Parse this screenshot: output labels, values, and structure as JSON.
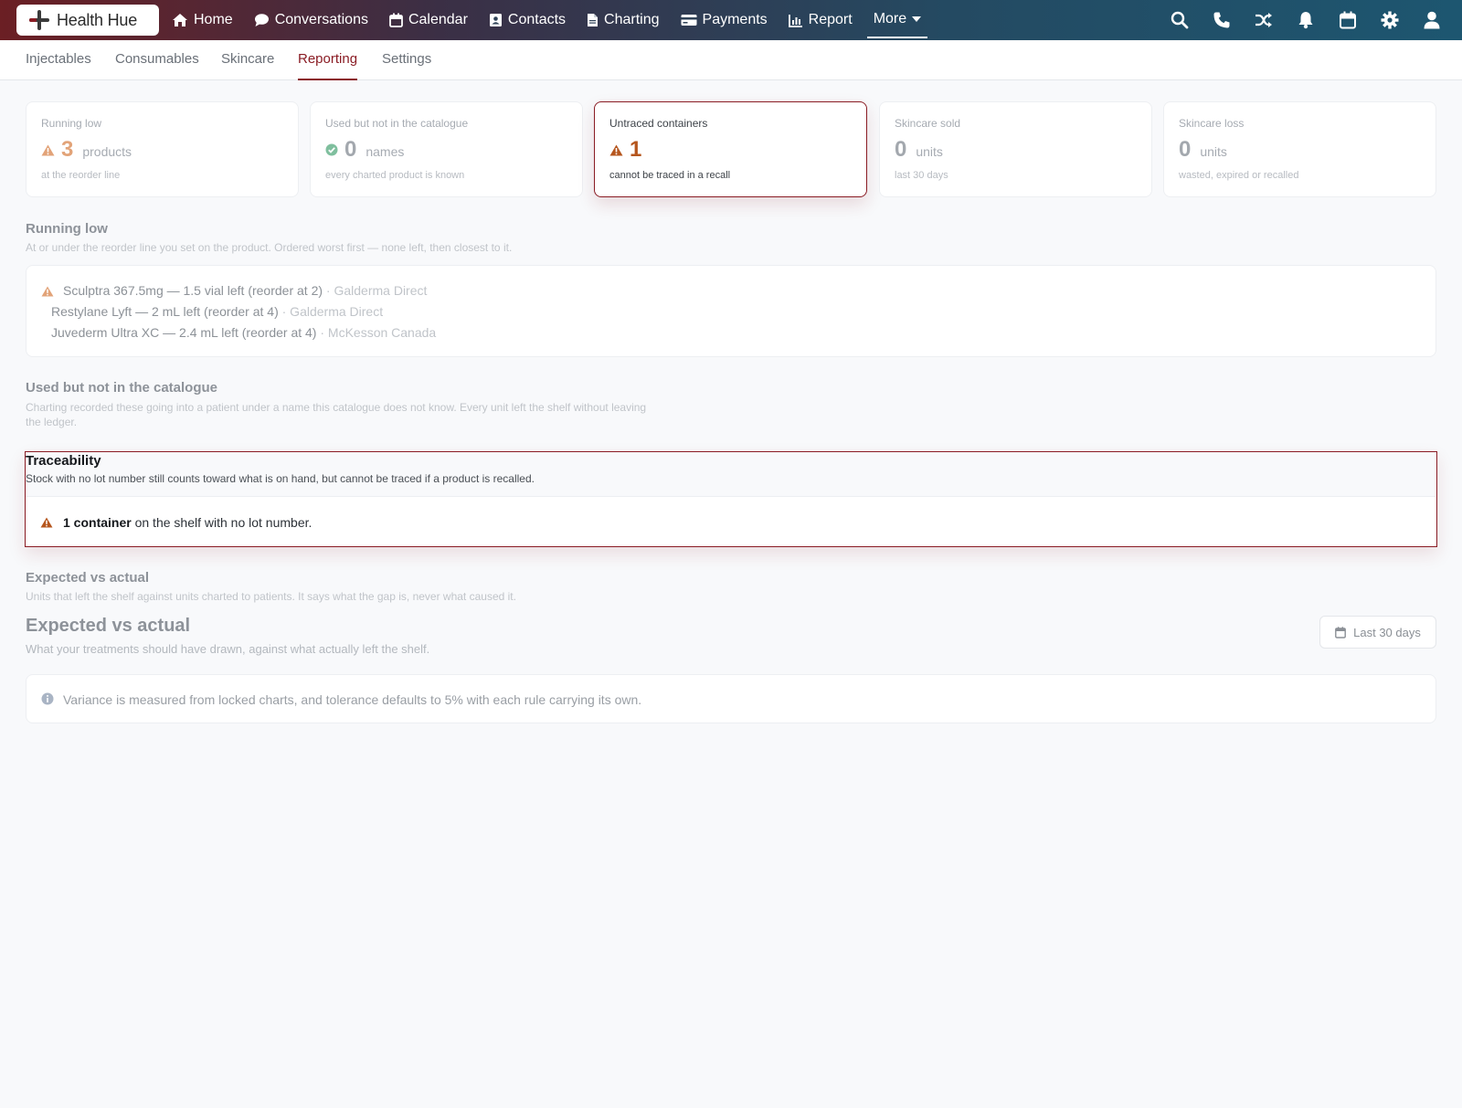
{
  "app": {
    "name": "Health Hue"
  },
  "nav": {
    "items": [
      {
        "label": "Home",
        "icon": "home-icon"
      },
      {
        "label": "Conversations",
        "icon": "chat-icon"
      },
      {
        "label": "Calendar",
        "icon": "calendar-icon"
      },
      {
        "label": "Contacts",
        "icon": "contact-card-icon"
      },
      {
        "label": "Charting",
        "icon": "document-icon"
      },
      {
        "label": "Payments",
        "icon": "credit-card-icon"
      },
      {
        "label": "Report",
        "icon": "bar-chart-icon"
      }
    ],
    "more_label": "More",
    "right_icons": [
      "search-icon",
      "phone-icon",
      "shuffle-icon",
      "bell-icon",
      "calendar-icon",
      "gear-icon",
      "user-icon"
    ]
  },
  "subtabs": {
    "items": [
      "Injectables",
      "Consumables",
      "Skincare",
      "Reporting",
      "Settings"
    ],
    "active": "Reporting"
  },
  "cards": [
    {
      "label": "Running low",
      "value": "3",
      "unit": "products",
      "sub": "at the reorder line",
      "status": "warning"
    },
    {
      "label": "Used but not in the catalogue",
      "value": "0",
      "unit": "names",
      "sub": "every charted product is known",
      "status": "ok"
    },
    {
      "label": "Untraced containers",
      "value": "1",
      "unit": "",
      "sub": "cannot be traced in a recall",
      "status": "warning",
      "selected": true
    },
    {
      "label": "Skincare sold",
      "value": "0",
      "unit": "units",
      "sub": "last 30 days",
      "status": "none"
    },
    {
      "label": "Skincare loss",
      "value": "0",
      "unit": "units",
      "sub": "wasted, expired or recalled",
      "status": "none"
    }
  ],
  "running_low": {
    "title": "Running low",
    "description": "At or under the reorder line you set on the product. Ordered worst first — none left, then closest to it.",
    "items": [
      {
        "text": "Sculptra 367.5mg — 1.5 vial left (reorder at 2)",
        "supplier": "· Galderma Direct",
        "warning": true
      },
      {
        "text": "Restylane Lyft — 2 mL left (reorder at 4)",
        "supplier": "· Galderma Direct",
        "warning": false
      },
      {
        "text": "Juvederm Ultra XC — 2.4 mL left (reorder at 4)",
        "supplier": "· McKesson Canada",
        "warning": false
      }
    ]
  },
  "not_in_catalogue": {
    "title": "Used but not in the catalogue",
    "description_line1": "Charting recorded these going into a patient under a name this catalogue does not know. Every unit left the shelf without leaving",
    "description_line2": "the ledger."
  },
  "traceability": {
    "title": "Traceability",
    "description": "Stock with no lot number still counts toward what is on hand, but cannot be traced if a product is recalled.",
    "message_bold": "1 container",
    "message_rest": " on the shelf with no lot number."
  },
  "expected_vs_actual": {
    "title": "Expected vs actual",
    "description": "Units that left the shelf against units charted to patients. It says what the gap is, never what caused it.",
    "big_title": "Expected vs actual",
    "big_description": "What your treatments should have drawn, against what actually left the shelf.",
    "range_label": "Last 30 days",
    "info": "Variance is measured from locked charts, and tolerance defaults to 5% with each rule carrying its own."
  },
  "colors": {
    "accent": "#8a1c24",
    "warning": "#b5561e",
    "warning_soft": "#e2a378",
    "ok": "#5fb08a"
  }
}
